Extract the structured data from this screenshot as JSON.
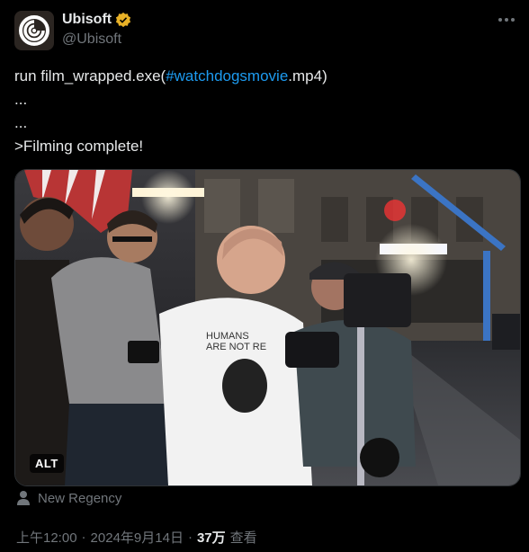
{
  "account": {
    "display_name": "Ubisoft",
    "handle": "@Ubisoft",
    "verified_color": "#e8b127"
  },
  "tweet": {
    "line1_prefix": "run film_wrapped.exe(",
    "line1_hashtag": "#watchdogsmovie",
    "line1_suffix": ".mp4)",
    "line2": "...",
    "line3": "...",
    "line4": ">Filming complete!"
  },
  "media": {
    "alt_label": "ALT",
    "shirt_text": "HUMANS ARE NOT RE"
  },
  "location": {
    "text": "New Regency"
  },
  "meta": {
    "time": "上午12:00",
    "separator": "·",
    "date": "2024年9月14日",
    "views": "37万",
    "views_label": "查看"
  },
  "colors": {
    "background": "#000000",
    "text": "#e7e9ea",
    "secondary": "#71767b",
    "link": "#1d9bf0"
  }
}
